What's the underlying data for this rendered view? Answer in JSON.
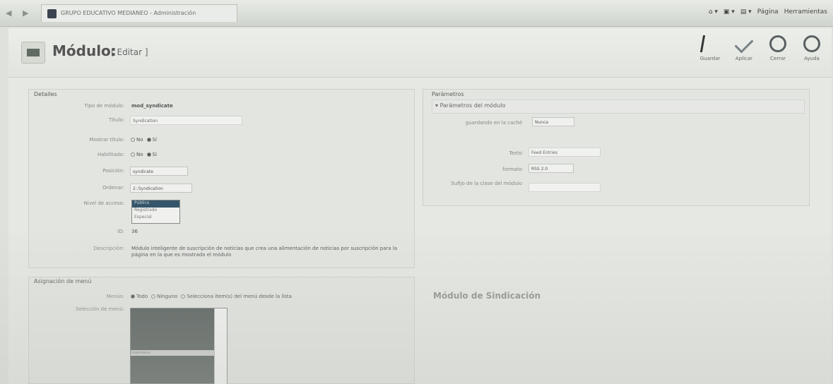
{
  "browser": {
    "tab_title": "GRUPO EDUCATIVO MEDIANEO - Administración",
    "tools": [
      "Página",
      "Herramientas"
    ]
  },
  "header": {
    "title": "Módulo:",
    "subtitle": "[ Editar ]",
    "buttons": [
      "Guardar",
      "Aplicar",
      "Cerrar",
      "Ayuda"
    ]
  },
  "details": {
    "legend": "Detalles",
    "type_label": "Tipo de módulo:",
    "type_value": "mod_syndicate",
    "title_label": "Título:",
    "title_value": "Syndication",
    "show_title_label": "Mostrar título:",
    "enabled_label": "Habilitado:",
    "radio_no": "No",
    "radio_yes": "Sí",
    "position_label": "Posición:",
    "position_value": "syndicate",
    "order_label": "Ordenar:",
    "order_value": "2::Syndication",
    "access_label": "Nivel de acceso:",
    "access_options": [
      "Público",
      "Registrado",
      "Especial"
    ],
    "id_label": "ID:",
    "id_value": "36",
    "description_label": "Descripción:",
    "description_value": "Módulo inteligente de suscripción de noticias que crea una alimentación de noticias por suscripción para la página en la que es mostrado el módulo"
  },
  "assignment": {
    "legend": "Asignación de menú",
    "menus_label": "Menús:",
    "all": "Todo",
    "none": "Ninguno",
    "select": "Selecciona item(s) del menú desde la lista",
    "selection_label": "Selección de menú:",
    "menu_text": "mainmenu"
  },
  "params": {
    "legend": "Parámetros",
    "subheading": "Parámetros del módulo",
    "cache_label": "guardando en la caché",
    "cache_value": "Nunca",
    "text_label": "Texto",
    "text_value": "Feed Entries",
    "format_label": "formato",
    "format_value": "RSS 2.0",
    "suffix_label": "Sufijo de la clase del módulo"
  },
  "background": {
    "title": "Módulo de Sindicación"
  }
}
